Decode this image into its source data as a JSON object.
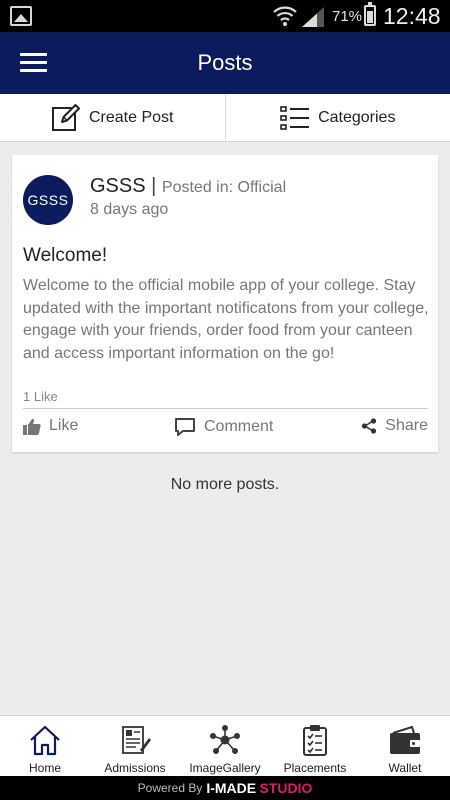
{
  "status_bar": {
    "battery": "71%",
    "battery_level": 0.71,
    "time": "12:48",
    "icons": [
      "image-notification-icon",
      "wifi-icon",
      "signal-icon",
      "battery-icon"
    ]
  },
  "app_bar": {
    "title": "Posts",
    "menu_icon": "hamburger-menu-icon",
    "color": "#0c1a5e"
  },
  "actions": {
    "create_post": "Create Post",
    "categories": "Categories"
  },
  "post": {
    "avatar_text": "GSSS",
    "author": "GSSS",
    "separator": "|",
    "posted_in": "Posted in: Official",
    "time_ago": "8 days ago",
    "title": "Welcome!",
    "body": "Welcome to the official mobile app of your college. Stay updated with the important notificatons from your college, engage with your friends, order food from your canteen and access important information on the go!",
    "likes_count": "1 Like",
    "like_label": "Like",
    "comment_label": "Comment",
    "share_label": "Share"
  },
  "feed_end": "No more posts.",
  "bottom_nav": {
    "items": [
      {
        "label": "Home",
        "icon": "home-icon"
      },
      {
        "label": "Admissions",
        "icon": "admissions-form-icon"
      },
      {
        "label": "ImageGallery",
        "icon": "network-gallery-icon"
      },
      {
        "label": "Placements",
        "icon": "clipboard-checklist-icon"
      },
      {
        "label": "Wallet",
        "icon": "wallet-icon"
      }
    ]
  },
  "footer": {
    "powered_by": "Powered By",
    "brand_part1": "I-MADE",
    "brand_part2": "STUDIO"
  }
}
